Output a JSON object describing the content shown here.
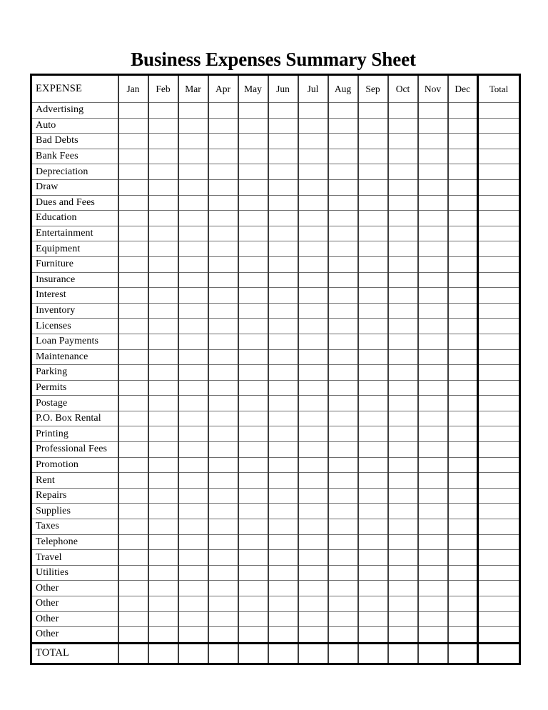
{
  "document": {
    "title": "Business Expenses Summary Sheet"
  },
  "table": {
    "columns": {
      "expense_header": "EXPENSE",
      "months": [
        "Jan",
        "Feb",
        "Mar",
        "Apr",
        "May",
        "Jun",
        "Jul",
        "Aug",
        "Sep",
        "Oct",
        "Nov",
        "Dec"
      ],
      "total_header": "Total"
    },
    "rows": [
      {
        "label": "Advertising",
        "values": [
          "",
          "",
          "",
          "",
          "",
          "",
          "",
          "",
          "",
          "",
          "",
          ""
        ],
        "total": ""
      },
      {
        "label": "Auto",
        "values": [
          "",
          "",
          "",
          "",
          "",
          "",
          "",
          "",
          "",
          "",
          "",
          ""
        ],
        "total": ""
      },
      {
        "label": "Bad Debts",
        "values": [
          "",
          "",
          "",
          "",
          "",
          "",
          "",
          "",
          "",
          "",
          "",
          ""
        ],
        "total": ""
      },
      {
        "label": "Bank Fees",
        "values": [
          "",
          "",
          "",
          "",
          "",
          "",
          "",
          "",
          "",
          "",
          "",
          ""
        ],
        "total": ""
      },
      {
        "label": "Depreciation",
        "values": [
          "",
          "",
          "",
          "",
          "",
          "",
          "",
          "",
          "",
          "",
          "",
          ""
        ],
        "total": ""
      },
      {
        "label": "Draw",
        "values": [
          "",
          "",
          "",
          "",
          "",
          "",
          "",
          "",
          "",
          "",
          "",
          ""
        ],
        "total": ""
      },
      {
        "label": "Dues and Fees",
        "values": [
          "",
          "",
          "",
          "",
          "",
          "",
          "",
          "",
          "",
          "",
          "",
          ""
        ],
        "total": ""
      },
      {
        "label": "Education",
        "values": [
          "",
          "",
          "",
          "",
          "",
          "",
          "",
          "",
          "",
          "",
          "",
          ""
        ],
        "total": ""
      },
      {
        "label": "Entertainment",
        "values": [
          "",
          "",
          "",
          "",
          "",
          "",
          "",
          "",
          "",
          "",
          "",
          ""
        ],
        "total": ""
      },
      {
        "label": "Equipment",
        "values": [
          "",
          "",
          "",
          "",
          "",
          "",
          "",
          "",
          "",
          "",
          "",
          ""
        ],
        "total": ""
      },
      {
        "label": "Furniture",
        "values": [
          "",
          "",
          "",
          "",
          "",
          "",
          "",
          "",
          "",
          "",
          "",
          ""
        ],
        "total": ""
      },
      {
        "label": "Insurance",
        "values": [
          "",
          "",
          "",
          "",
          "",
          "",
          "",
          "",
          "",
          "",
          "",
          ""
        ],
        "total": ""
      },
      {
        "label": "Interest",
        "values": [
          "",
          "",
          "",
          "",
          "",
          "",
          "",
          "",
          "",
          "",
          "",
          ""
        ],
        "total": ""
      },
      {
        "label": "Inventory",
        "values": [
          "",
          "",
          "",
          "",
          "",
          "",
          "",
          "",
          "",
          "",
          "",
          ""
        ],
        "total": ""
      },
      {
        "label": "Licenses",
        "values": [
          "",
          "",
          "",
          "",
          "",
          "",
          "",
          "",
          "",
          "",
          "",
          ""
        ],
        "total": ""
      },
      {
        "label": "Loan Payments",
        "values": [
          "",
          "",
          "",
          "",
          "",
          "",
          "",
          "",
          "",
          "",
          "",
          ""
        ],
        "total": ""
      },
      {
        "label": "Maintenance",
        "values": [
          "",
          "",
          "",
          "",
          "",
          "",
          "",
          "",
          "",
          "",
          "",
          ""
        ],
        "total": ""
      },
      {
        "label": "Parking",
        "values": [
          "",
          "",
          "",
          "",
          "",
          "",
          "",
          "",
          "",
          "",
          "",
          ""
        ],
        "total": ""
      },
      {
        "label": "Permits",
        "values": [
          "",
          "",
          "",
          "",
          "",
          "",
          "",
          "",
          "",
          "",
          "",
          ""
        ],
        "total": ""
      },
      {
        "label": "Postage",
        "values": [
          "",
          "",
          "",
          "",
          "",
          "",
          "",
          "",
          "",
          "",
          "",
          ""
        ],
        "total": ""
      },
      {
        "label": "P.O. Box Rental",
        "values": [
          "",
          "",
          "",
          "",
          "",
          "",
          "",
          "",
          "",
          "",
          "",
          ""
        ],
        "total": ""
      },
      {
        "label": "Printing",
        "values": [
          "",
          "",
          "",
          "",
          "",
          "",
          "",
          "",
          "",
          "",
          "",
          ""
        ],
        "total": ""
      },
      {
        "label": "Professional Fees",
        "values": [
          "",
          "",
          "",
          "",
          "",
          "",
          "",
          "",
          "",
          "",
          "",
          ""
        ],
        "total": ""
      },
      {
        "label": "Promotion",
        "values": [
          "",
          "",
          "",
          "",
          "",
          "",
          "",
          "",
          "",
          "",
          "",
          ""
        ],
        "total": ""
      },
      {
        "label": "Rent",
        "values": [
          "",
          "",
          "",
          "",
          "",
          "",
          "",
          "",
          "",
          "",
          "",
          ""
        ],
        "total": ""
      },
      {
        "label": "Repairs",
        "values": [
          "",
          "",
          "",
          "",
          "",
          "",
          "",
          "",
          "",
          "",
          "",
          ""
        ],
        "total": ""
      },
      {
        "label": "Supplies",
        "values": [
          "",
          "",
          "",
          "",
          "",
          "",
          "",
          "",
          "",
          "",
          "",
          ""
        ],
        "total": ""
      },
      {
        "label": "Taxes",
        "values": [
          "",
          "",
          "",
          "",
          "",
          "",
          "",
          "",
          "",
          "",
          "",
          ""
        ],
        "total": ""
      },
      {
        "label": "Telephone",
        "values": [
          "",
          "",
          "",
          "",
          "",
          "",
          "",
          "",
          "",
          "",
          "",
          ""
        ],
        "total": ""
      },
      {
        "label": "Travel",
        "values": [
          "",
          "",
          "",
          "",
          "",
          "",
          "",
          "",
          "",
          "",
          "",
          ""
        ],
        "total": ""
      },
      {
        "label": "Utilities",
        "values": [
          "",
          "",
          "",
          "",
          "",
          "",
          "",
          "",
          "",
          "",
          "",
          ""
        ],
        "total": ""
      },
      {
        "label": "Other",
        "values": [
          "",
          "",
          "",
          "",
          "",
          "",
          "",
          "",
          "",
          "",
          "",
          ""
        ],
        "total": ""
      },
      {
        "label": "Other",
        "values": [
          "",
          "",
          "",
          "",
          "",
          "",
          "",
          "",
          "",
          "",
          "",
          ""
        ],
        "total": ""
      },
      {
        "label": "Other",
        "values": [
          "",
          "",
          "",
          "",
          "",
          "",
          "",
          "",
          "",
          "",
          "",
          ""
        ],
        "total": ""
      },
      {
        "label": "Other",
        "values": [
          "",
          "",
          "",
          "",
          "",
          "",
          "",
          "",
          "",
          "",
          "",
          ""
        ],
        "total": ""
      }
    ],
    "total_row": {
      "label": "TOTAL",
      "values": [
        "",
        "",
        "",
        "",
        "",
        "",
        "",
        "",
        "",
        "",
        "",
        ""
      ],
      "total": ""
    }
  }
}
